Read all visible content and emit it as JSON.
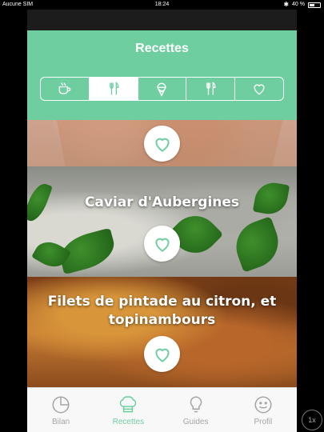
{
  "status_bar": {
    "carrier": "Aucune SIM",
    "time": "18:24",
    "battery_text": "40 %",
    "battery_level": 0.4
  },
  "header": {
    "title": "Recettes"
  },
  "categories": [
    {
      "icon": "coffee-cup-icon",
      "selected": false
    },
    {
      "icon": "fork-knife-icon",
      "selected": true
    },
    {
      "icon": "ice-cream-icon",
      "selected": false
    },
    {
      "icon": "fork-knife-icon",
      "selected": false
    },
    {
      "icon": "heart-icon",
      "selected": false
    }
  ],
  "recipes": [
    {
      "name": ""
    },
    {
      "name": "Caviar d'Aubergines"
    },
    {
      "name": "Filets de pintade au citron, et topinambours"
    }
  ],
  "tabbar": {
    "tabs": [
      {
        "label": "Bilan",
        "icon": "pie-chart-icon",
        "active": false
      },
      {
        "label": "Recettes",
        "icon": "chef-hat-icon",
        "active": true
      },
      {
        "label": "Guides",
        "icon": "lightbulb-icon",
        "active": false
      },
      {
        "label": "Profil",
        "icon": "smiley-icon",
        "active": false
      }
    ]
  },
  "zoom": {
    "label": "1x"
  },
  "colors": {
    "accent": "#6fcea0",
    "inactive": "#a5a5a5"
  }
}
